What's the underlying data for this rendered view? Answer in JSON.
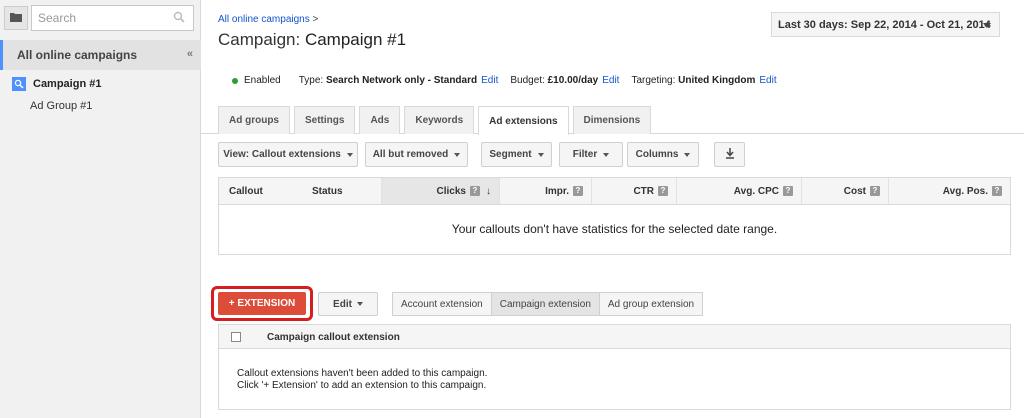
{
  "sidebar": {
    "search_placeholder": "Search",
    "all_campaigns": "All online campaigns",
    "collapse_glyph": "«",
    "campaign": "Campaign #1",
    "ad_group": "Ad Group #1"
  },
  "header": {
    "breadcrumb": "All online campaigns",
    "breadcrumb_sep": ">",
    "title_prefix": "Campaign:",
    "title_name": "Campaign #1",
    "date_range": "Last 30 days: Sep 22, 2014 - Oct 21, 2014"
  },
  "status": {
    "enabled": "Enabled",
    "type_label": "Type:",
    "type_value": "Search Network only - Standard",
    "budget_label": "Budget:",
    "budget_value": "£10.00/day",
    "targeting_label": "Targeting:",
    "targeting_value": "United Kingdom",
    "edit": "Edit"
  },
  "tabs": [
    {
      "label": "Ad groups"
    },
    {
      "label": "Settings"
    },
    {
      "label": "Ads"
    },
    {
      "label": "Keywords"
    },
    {
      "label": "Ad extensions"
    },
    {
      "label": "Dimensions"
    }
  ],
  "active_tab": "Ad extensions",
  "toolbar": {
    "view": "View: Callout extensions",
    "filter_removed": "All but removed",
    "segment": "Segment",
    "filter": "Filter",
    "columns": "Columns"
  },
  "stats_table": {
    "columns": [
      "Callout",
      "Status",
      "Clicks",
      "Impr.",
      "CTR",
      "Avg. CPC",
      "Cost",
      "Avg. Pos."
    ],
    "sort_glyph": "↓",
    "help_glyph": "?",
    "empty_message": "Your callouts don't have statistics for the selected date range."
  },
  "extensions": {
    "add_button": "+ EXTENSION",
    "edit_button": "Edit",
    "levels": [
      "Account extension",
      "Campaign extension",
      "Ad group extension"
    ],
    "active_level": "Campaign extension",
    "column": "Campaign callout extension",
    "empty_line1": "Callout extensions haven't been added to this campaign.",
    "empty_line2": "Click '+ Extension' to add an extension to this campaign."
  },
  "colors": {
    "accent": "#4d90fe",
    "link": "#1155cc",
    "add_button": "#dd4b39",
    "highlight_ring": "#d61e1e",
    "enabled_dot": "#2a9d3a"
  }
}
